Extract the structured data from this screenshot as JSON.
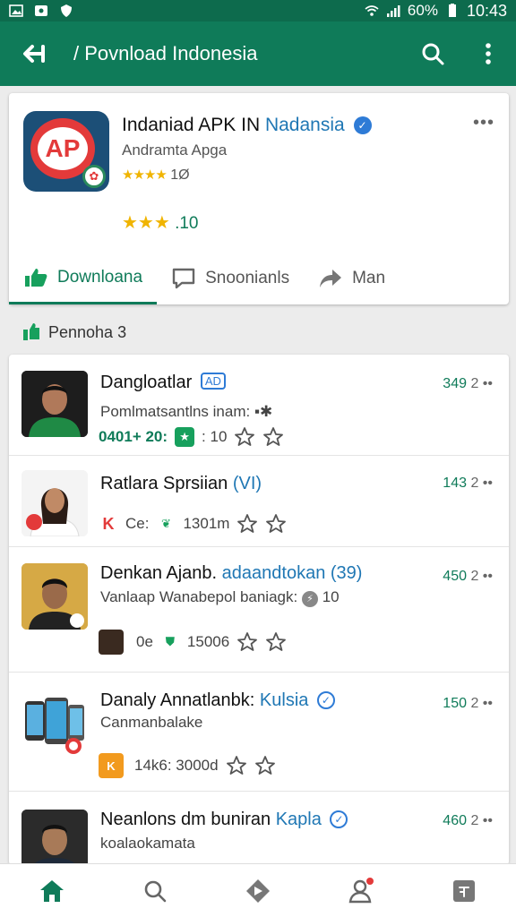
{
  "status_bar": {
    "battery": "60%",
    "time": "10:43"
  },
  "app_bar": {
    "title": "/ Povnload Indonesia"
  },
  "app_card": {
    "name_main": "Indaniad APK IN",
    "name_accent": "Nadansia",
    "subtitle": "Andramta Apga",
    "small_rating_text": "1Ø",
    "rating_value": ".10",
    "actions": [
      {
        "label": "Downloana"
      },
      {
        "label": "Snoonianls"
      },
      {
        "label": "Man"
      }
    ]
  },
  "section": {
    "label": "Pennoha 3"
  },
  "list": [
    {
      "name": "Dangloatlar",
      "badge": "AD",
      "desc": "Pomlmatsantlns inam: ▪✱",
      "meta_text": "0401+ 20:",
      "meta_text2": ": 10",
      "score": "349",
      "more": "2 ••"
    },
    {
      "name": "Ratlara Sprsiian",
      "accent": "(VI)",
      "desc": "",
      "meta_text": "Ce:",
      "meta_text2": "1301m",
      "score": "143",
      "more": "2 ••"
    },
    {
      "name": "Denkan Ajanb.",
      "accent": "adaandtokan (39)",
      "desc": "Vanlaap Wanabepol baniagk:",
      "desc_tail": "10",
      "meta_text": "0e",
      "meta_text2": "15006",
      "score": "450",
      "more": "2 ••"
    },
    {
      "name": "Danaly Annatlanbk:",
      "accent": "Kulsia",
      "desc": "Canmanbalake",
      "meta_text": "14k6: 3000d",
      "meta_text2": "",
      "score": "150",
      "more": "2 ••"
    },
    {
      "name": "Neanlons dm buniran",
      "accent": "Kapla",
      "desc": "koalaokamata",
      "score": "460",
      "more": "2 ••"
    }
  ],
  "colors": {
    "primary": "#0f7b59",
    "accent": "#1f77b4",
    "star": "#f0b400",
    "badge_red": "#e33a3a"
  }
}
